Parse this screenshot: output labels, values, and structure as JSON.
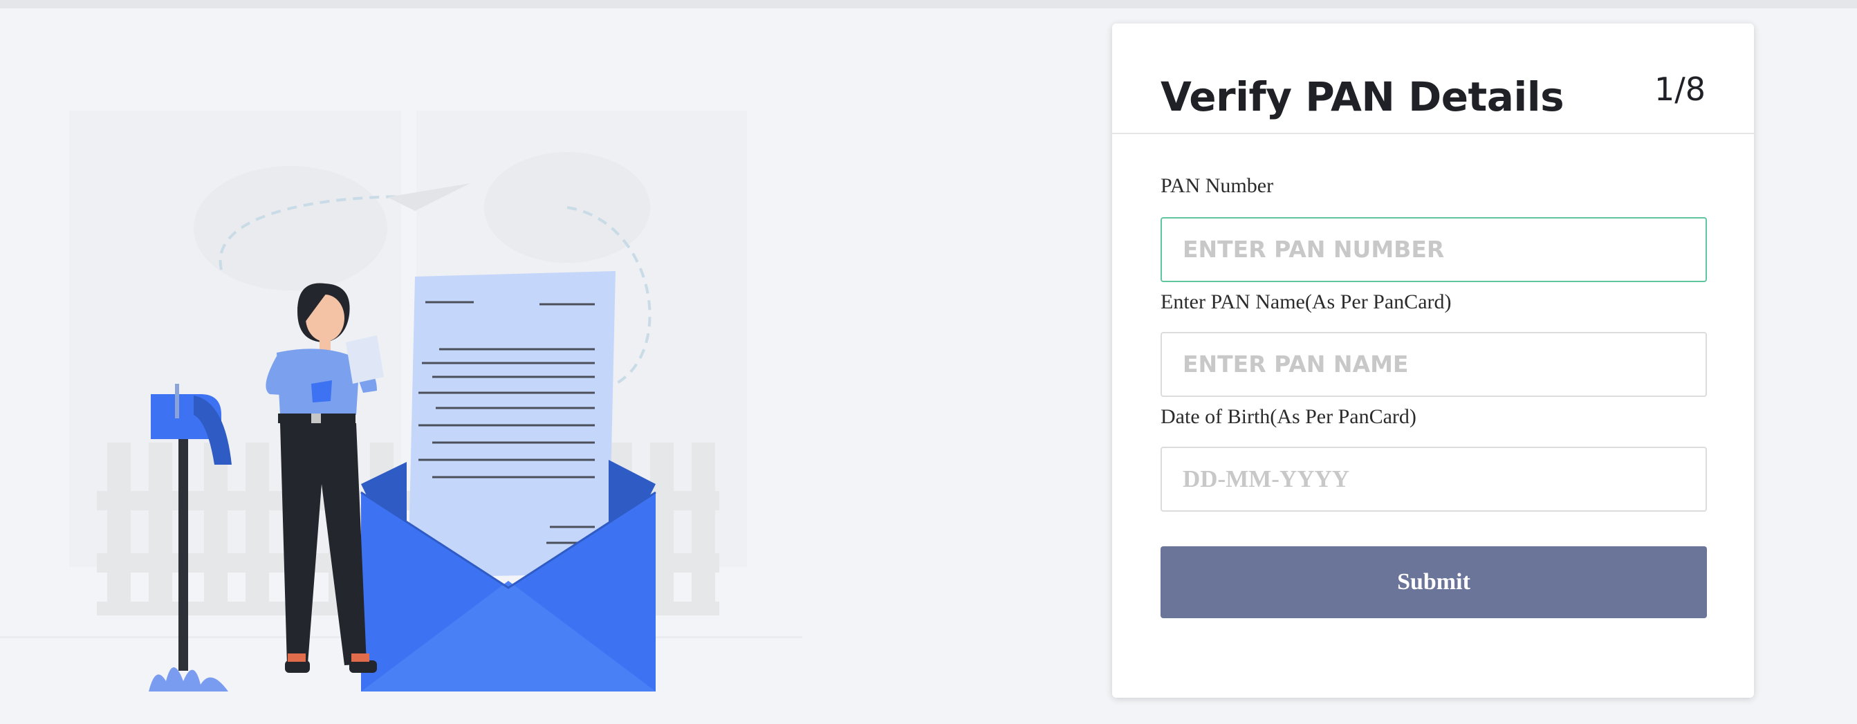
{
  "form": {
    "title": "Verify PAN Details",
    "step": "1/8",
    "fields": [
      {
        "label": "PAN Number",
        "placeholder": "ENTER PAN NUMBER",
        "value": ""
      },
      {
        "label": "Enter PAN Name(As Per PanCard)",
        "placeholder": "ENTER PAN NAME",
        "value": ""
      },
      {
        "label": "Date of Birth(As Per PanCard)",
        "placeholder": "DD-MM-YYYY",
        "value": ""
      }
    ],
    "submit_label": "Submit"
  },
  "illustration": {
    "icons": [
      "mailbox-icon",
      "woman-reading-letter",
      "letter-icon",
      "envelope-icon",
      "paper-plane-icon",
      "fence",
      "bush"
    ]
  },
  "colors": {
    "accent_blue": "#3d72f2",
    "light_blue": "#c5d6fb",
    "button": "#6b7599",
    "focus_border": "#5fc6a0",
    "background": "#f3f4f7",
    "card": "#ffffff"
  }
}
